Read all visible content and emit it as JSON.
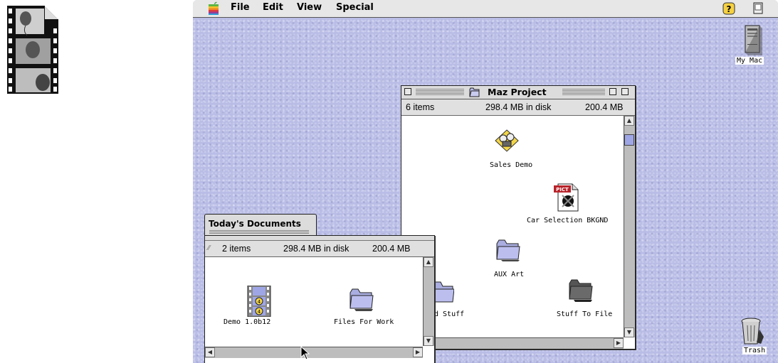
{
  "menubar": {
    "apple_icon": "apple-rainbow-icon",
    "items": [
      "File",
      "Edit",
      "View",
      "Special"
    ],
    "right_icons": [
      "help-icon",
      "application-menu-icon"
    ]
  },
  "desktop": {
    "icons": [
      {
        "label": "My Mac",
        "icon": "computer-icon"
      },
      {
        "label": "Trash",
        "icon": "trash-icon"
      }
    ],
    "standalone_icon": "film-strip-document-icon"
  },
  "maz_window": {
    "title": "Maz Project",
    "info": {
      "items": "6 items",
      "disk": "298.4 MB in disk",
      "avail": "200.4 MB"
    },
    "icons": [
      {
        "label": "Sales Demo",
        "icon": "projector-app-icon"
      },
      {
        "label": "Car Selection BKGND",
        "icon": "pict-file-icon",
        "badge": "PICT"
      },
      {
        "label": "AUX Art",
        "icon": "folder-icon"
      },
      {
        "label": "d Stuff",
        "icon": "folder-icon"
      },
      {
        "label": "Stuff To File",
        "icon": "dark-folder-icon"
      }
    ]
  },
  "today_window": {
    "tab_title": "Today's Documents",
    "info": {
      "items": "2 items",
      "disk": "298.4 MB in disk",
      "avail": "200.4 MB"
    },
    "icons": [
      {
        "label": "Demo 1.0b12",
        "icon": "movie-film-icon"
      },
      {
        "label": "Files For Work",
        "icon": "folder-icon"
      }
    ]
  },
  "colors": {
    "desktop": "#b9bde6",
    "folder": "#b9bce8",
    "window_bg": "#ffffff",
    "chrome": "#dcdcdc"
  }
}
